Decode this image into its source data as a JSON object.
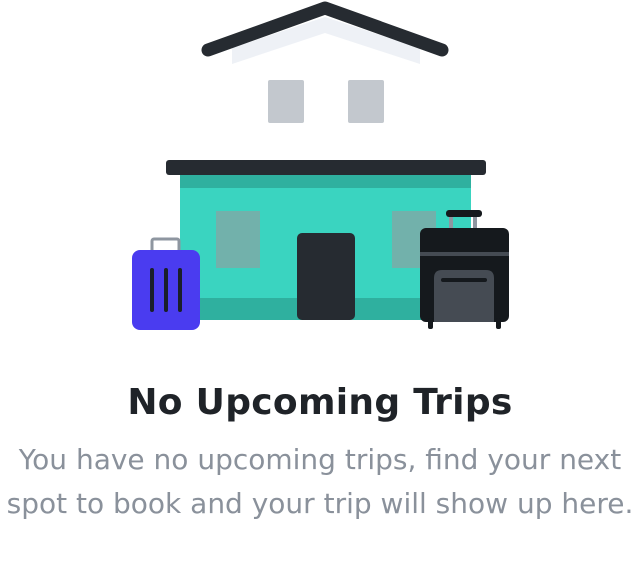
{
  "empty_state": {
    "title": "No Upcoming Trips",
    "message": "You have no upcoming trips, find your next spot to book and your trip will show up here.",
    "illustration_icon": "house-with-luggage-icon"
  },
  "colors": {
    "roof": "#262b31",
    "roof_shadow": "#eef1f6",
    "window_upper": "#c3c8ce",
    "house_body": "#3ad4c0",
    "house_band": "#2fb09f",
    "window_lower": "#72b1ab",
    "door": "#262b31",
    "suitcase_blue": "#4a3cf0",
    "suitcase_black": "#15191d",
    "suitcase_pocket": "#454b53",
    "title_text": "#1f2328",
    "message_text": "#8a919b"
  }
}
